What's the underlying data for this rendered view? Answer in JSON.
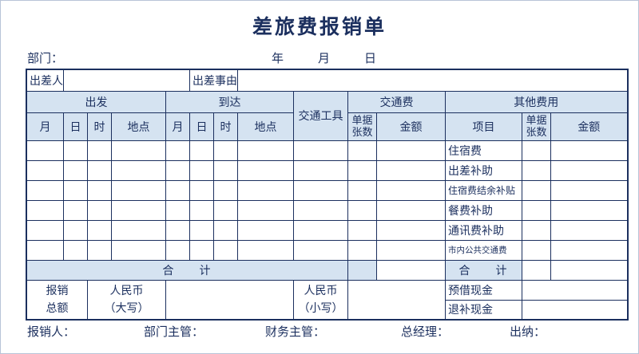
{
  "form": {
    "title": "差旅费报销单",
    "dept_label": "部门：",
    "year_label": "年",
    "month_label": "月",
    "day_label": "日"
  },
  "row1": {
    "traveler_label": "出差人",
    "reason_label": "出差事由"
  },
  "headers": {
    "depart": "出发",
    "arrive": "到达",
    "transport_tool": "交通工具",
    "transport_fee": "交通费",
    "other_fees": "其他费用",
    "month": "月",
    "day": "日",
    "hour": "时",
    "place": "地点",
    "receipt_line1": "单据",
    "receipt_line2": "张数",
    "amount": "金额",
    "item": "项目"
  },
  "other_items": [
    "住宿费",
    "出差补助",
    "住宿费结余补贴",
    "餐费补助",
    "通讯费补助",
    "市内公共交通费"
  ],
  "totals": {
    "left_total_a": "合",
    "left_total_b": "计",
    "right_total_a": "合",
    "right_total_b": "计",
    "reimburse_line1": "报销",
    "reimburse_line2": "总额",
    "rmb_upper_line1": "人民币",
    "rmb_upper_line2": "（大写）",
    "rmb_lower_line1": "人民币",
    "rmb_lower_line2": "（小写）",
    "advance_cash": "预借现金",
    "refund_cash": "退补现金"
  },
  "footer": {
    "claimant": "报销人：",
    "dept_head": "部门主管：",
    "finance_head": "财务主管：",
    "general_manager": "总经理：",
    "cashier": "出纳："
  }
}
